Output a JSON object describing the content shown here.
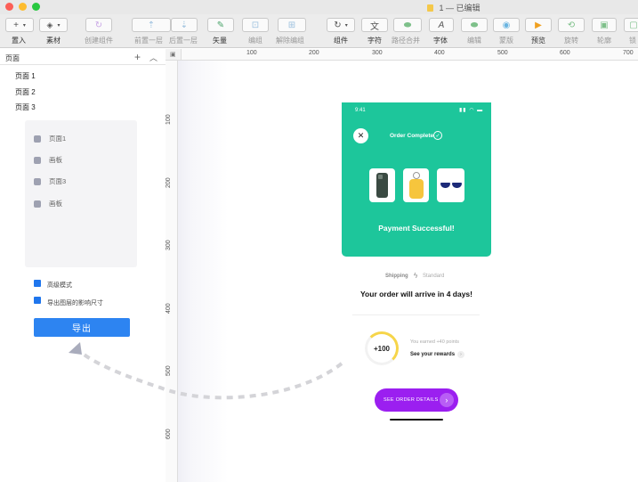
{
  "window": {
    "title": "1 — 已编辑"
  },
  "toolbar": {
    "items": [
      "置入",
      "素材",
      "创建组件",
      "前置一层",
      "后置一层",
      "矢量",
      "编组",
      "解除编组",
      "组件",
      "字符",
      "路径合并",
      "字体",
      "编辑",
      "蒙版",
      "预览",
      "旋转",
      "轮廓",
      "锁"
    ],
    "add_glyph": "+",
    "text_glyph": "文",
    "font_glyph": "A"
  },
  "layers": {
    "header": "页面",
    "pages": [
      "页面 1",
      "页面 2",
      "页面 3"
    ],
    "list": [
      "页面1",
      "画板",
      "页面3",
      "画板"
    ],
    "options": [
      "高级模式",
      "导出图层的影响尺寸"
    ],
    "export_label": "导出"
  },
  "ruler": {
    "h": [
      "100",
      "200",
      "300",
      "400",
      "500",
      "600",
      "700"
    ],
    "v": [
      "100",
      "200",
      "300",
      "400",
      "500",
      "600"
    ]
  },
  "phone": {
    "time": "9:41",
    "order_complete": "Order Complete",
    "payment": "Payment Successful!",
    "shipping": "Shipping",
    "standard": "Standard",
    "arrive": "Your order will arrive in 4 days!",
    "points": "+100",
    "earned": "You earned +40 points",
    "rewards": "See your rewards",
    "button": "SEE ORDER DETAILS"
  },
  "colors": {
    "accent_green": "#1dc69b",
    "accent_purple": "#9b1ff0",
    "export_blue": "#2d84f1"
  }
}
